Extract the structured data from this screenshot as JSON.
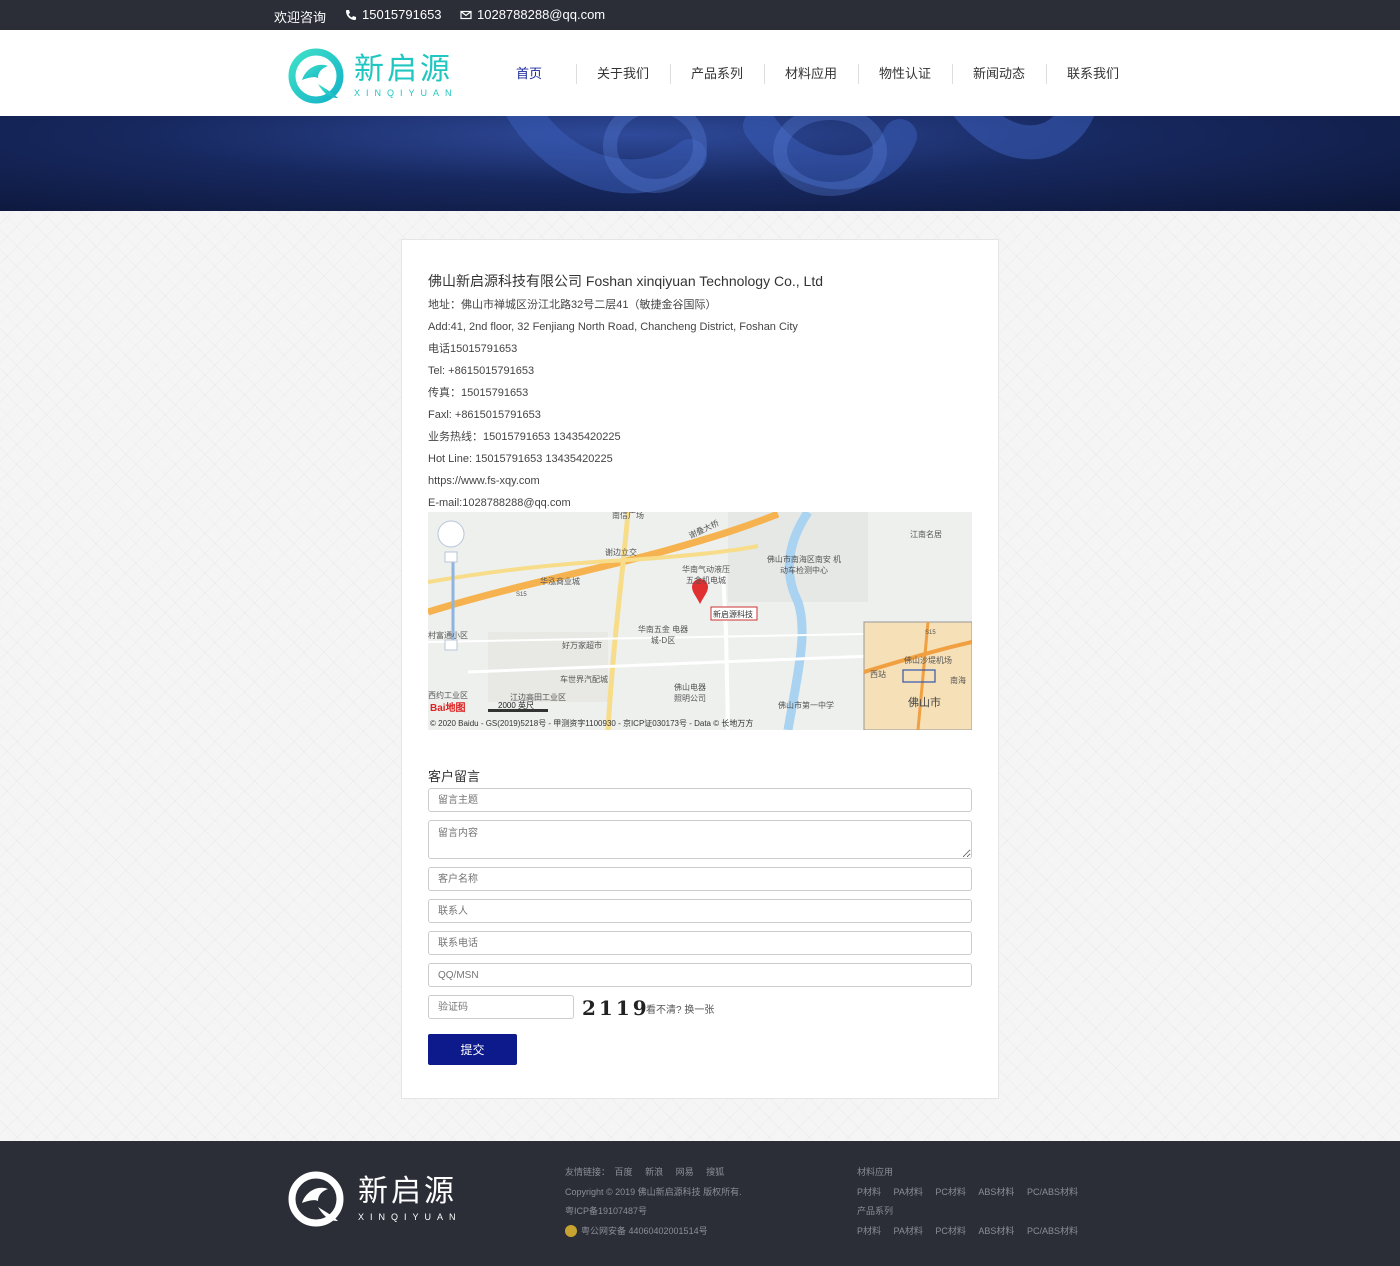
{
  "topbar": {
    "welcome": "欢迎咨询",
    "phone": "15015791653",
    "email": "1028788288@qq.com"
  },
  "logo": {
    "cn": "新启源",
    "en": "XINQIYUAN"
  },
  "nav": {
    "items": [
      {
        "label": "首页"
      },
      {
        "label": "关于我们"
      },
      {
        "label": "产品系列"
      },
      {
        "label": "材料应用"
      },
      {
        "label": "物性认证"
      },
      {
        "label": "新闻动态"
      },
      {
        "label": "联系我们"
      }
    ]
  },
  "contact": {
    "company": "佛山新启源科技有限公司 Foshan xinqiyuan Technology Co., Ltd",
    "lines": [
      "地址：佛山市禅城区汾江北路32号二层41（敏捷金谷国际）",
      "Add:41, 2nd floor, 32 Fenjiang North Road, Chancheng District, Foshan City",
      "电话15015791653",
      "Tel: +8615015791653",
      "传真：15015791653",
      "Faxl: +8615015791653",
      "业务热线：15015791653 13435420225",
      "Hot Line: 15015791653 13435420225",
      "https://www.fs-xqy.com",
      "E-mail:1028788288@qq.com"
    ]
  },
  "map": {
    "labels": {
      "a": "谢边立交",
      "b": "谢叠大桥",
      "c": "华南气动液压 五金机电城",
      "d": "佛山市南海区南安 机动车检测中心",
      "e": "江南名居",
      "f": "华泓商业城",
      "g": "新启源科技",
      "h": "华南五金 电器城-D区",
      "i": "好万家超市",
      "j": "车世界汽配城",
      "k": "佛山电器 照明公司",
      "l": "江边高田工业区",
      "m": "佛山市第一中学",
      "n": "西约工业区",
      "o": "村富通小区",
      "p": "佛山市",
      "q": "佛山沙堤机场",
      "r": "西站",
      "s": "南海",
      "t": "南信广场",
      "road1": "S15",
      "road2": "S15",
      "scale": "2000 英尺"
    },
    "brand": "Bai地图",
    "copyright": "© 2020 Baidu - GS(2019)5218号 - 甲测资字1100930 - 京ICP证030173号 - Data © 长地万方"
  },
  "form": {
    "title": "客户留言",
    "subject_ph": "留言主题",
    "content_ph": "留言内容",
    "customer_ph": "客户名称",
    "contact_ph": "联系人",
    "phone_ph": "联系电话",
    "qq_ph": "QQ/MSN",
    "captcha_ph": "验证码",
    "captcha_text": "2119",
    "captcha_refresh": "看不清? 换一张",
    "submit": "提交"
  },
  "footer": {
    "logo_cn": "新启源",
    "logo_en": "XINQIYUAN",
    "links_label": "友情链接：",
    "links": [
      "百度",
      "新浪",
      "网易",
      "搜狐"
    ],
    "copyright": "Copyright © 2019 佛山新启源科技 版权所有.",
    "icp": "粤ICP备19107487号",
    "police": "粤公网安备 44060402001514号",
    "col2_title1": "材料应用",
    "col2_items1": [
      "P材料",
      "PA材料",
      "PC材料",
      "ABS材料",
      "PC/ABS材料"
    ],
    "col2_title2": "产品系列",
    "col2_items2": [
      "P材料",
      "PA材料",
      "PC材料",
      "ABS材料",
      "PC/ABS材料"
    ]
  },
  "colors": {
    "accent": "#1fc7c0",
    "nav_active": "#1a2a9a",
    "submit_bg": "#0d1a8c",
    "topbar_bg": "#2b2e37"
  }
}
